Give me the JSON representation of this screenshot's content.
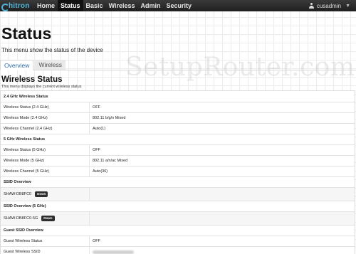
{
  "navbar": {
    "brand": "hitron",
    "items": [
      {
        "label": "Home",
        "active": false
      },
      {
        "label": "Status",
        "active": true
      },
      {
        "label": "Basic",
        "active": false
      },
      {
        "label": "Wireless",
        "active": false
      },
      {
        "label": "Admin",
        "active": false
      },
      {
        "label": "Security",
        "active": false
      }
    ],
    "user": "cusadmin"
  },
  "page": {
    "title": "Status",
    "subtitle": "This menu show the status of the device",
    "watermark": "SetupRouter.com"
  },
  "tabs": [
    {
      "label": "Overview",
      "active": true
    },
    {
      "label": "Wireless",
      "active": false
    }
  ],
  "section": {
    "title": "Wireless Status",
    "description": "This menu displays the current wireless status"
  },
  "table": {
    "g24_header": "2.4 GHz Wireless Status",
    "g24_status_label": "Wireless Status (2.4 GHz)",
    "g24_status_value": "OFF",
    "g24_mode_label": "Wireless Mode (2.4 GHz)",
    "g24_mode_value": "802.11 b/g/n Mixed",
    "g24_channel_label": "Wireless Channel (2.4 GHz)",
    "g24_channel_value": "Auto(1)",
    "g5_header": "5 GHz Wireless Status",
    "g5_status_label": "Wireless Status (5 GHz)",
    "g5_status_value": "OFF",
    "g5_mode_label": "Wireless Mode (5 GHz)",
    "g5_mode_value": "802.11 a/n/ac Mixed",
    "g5_channel_label": "Wireless Channel (5 GHz)",
    "g5_channel_value": "Auto(36)",
    "ssid_header": "SSID Overview",
    "ssid_name": "SHAW-DB8FC0",
    "ssid_badge": "Down",
    "ssid5_header": "SSID Overview (5 GHz)",
    "ssid5_name": "SHAW-DB8FC0-5G",
    "ssid5_badge": "Down",
    "guest_header": "Guest SSID Overview",
    "guest_status_label": "Guest Wireless Status",
    "guest_status_value": "OFF",
    "guest_ssid_label": "Guest Wireless SSID"
  },
  "colors": {
    "navbar": "#2a2a2a",
    "brand": "#55b6da",
    "link": "#3a7abf",
    "badge": "#2e2e2e"
  },
  "icons": {
    "user": "user-icon",
    "caret": "chevron-down-icon",
    "brand": "hitron-logo-icon"
  }
}
